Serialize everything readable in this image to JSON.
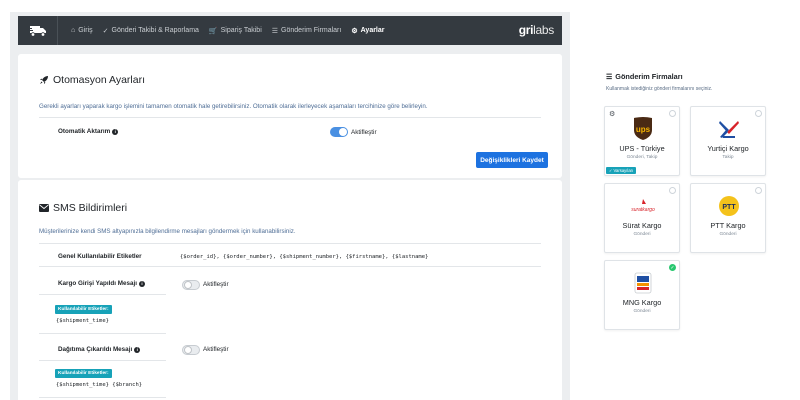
{
  "nav": {
    "items": [
      {
        "icon": "home-icon",
        "glyph": "⌂",
        "label": "Giriş"
      },
      {
        "icon": "truck-check-icon",
        "glyph": "✓",
        "label": "Gönderi Takibi & Raporlama"
      },
      {
        "icon": "cart-icon",
        "glyph": "🛒",
        "label": "Sipariş Takibi"
      },
      {
        "icon": "list-icon",
        "glyph": "☰",
        "label": "Gönderim Firmaları"
      },
      {
        "icon": "gears-icon",
        "glyph": "⚙",
        "label": "Ayarlar"
      }
    ],
    "brand_bold": "gri",
    "brand_light": "labs"
  },
  "automation": {
    "title": "Otomasyon Ayarları",
    "description": "Gerekli ayarları yaparak kargo işlemini tamamen otomatik hale getirebilirsiniz. Otomatik olarak ilerleyecek aşamaları tercihinize göre belirleyin.",
    "auto_label": "Otomatik Aktarım",
    "auto_toggle_label": "Aktifleştir",
    "auto_enabled": true,
    "save_label": "Değişiklikleri Kaydet"
  },
  "sms": {
    "title": "SMS Bildirimleri",
    "description": "Müşterilerinize kendi SMS altyapınızla bilgilendirme mesajları göndermek için kullanabilirsiniz.",
    "general_label": "Genel Kullanılabilir Etiketler",
    "general_tags": "{$order_id}, {$order_number}, {$shipment_number}, {$firstname}, {$lastname}",
    "usable_tags_label": "Kullanılabilir Etiketler:",
    "rows": [
      {
        "label": "Kargo Girişi Yapıldı Mesajı",
        "toggle_label": "Aktifleştir",
        "enabled": false,
        "tags": "{$shipment_time}"
      },
      {
        "label": "Dağıtıma Çıkarıldı Mesajı",
        "toggle_label": "Aktifleştir",
        "enabled": false,
        "tags": "{$shipment_time} {$branch}"
      }
    ]
  },
  "carriers": {
    "title": "Gönderim Firmaları",
    "description": "Kullanmak istediğiniz gönderi firmalarını seçiniz.",
    "default_badge": "Varsayılan",
    "items": [
      {
        "name": "UPS - Türkiye",
        "sub": "Gönderi, Takip",
        "logo": "ups-logo",
        "selected": false,
        "is_default": true
      },
      {
        "name": "Yurtiçi Kargo",
        "sub": "Takip",
        "logo": "yurtici-logo",
        "selected": false,
        "is_default": false
      },
      {
        "name": "Sürat Kargo",
        "sub": "Gönderi",
        "logo": "surat-logo",
        "selected": false,
        "is_default": false
      },
      {
        "name": "PTT Kargo",
        "sub": "Gönderi",
        "logo": "ptt-logo",
        "selected": false,
        "is_default": false
      },
      {
        "name": "MNG Kargo",
        "sub": "Gönderi",
        "logo": "mng-logo",
        "selected": true,
        "is_default": false
      }
    ]
  },
  "colors": {
    "navbar": "#343a40",
    "primary": "#1d72e0",
    "toggle_on": "#4a90e2",
    "badge": "#17a2b8",
    "selected": "#28c76f"
  }
}
